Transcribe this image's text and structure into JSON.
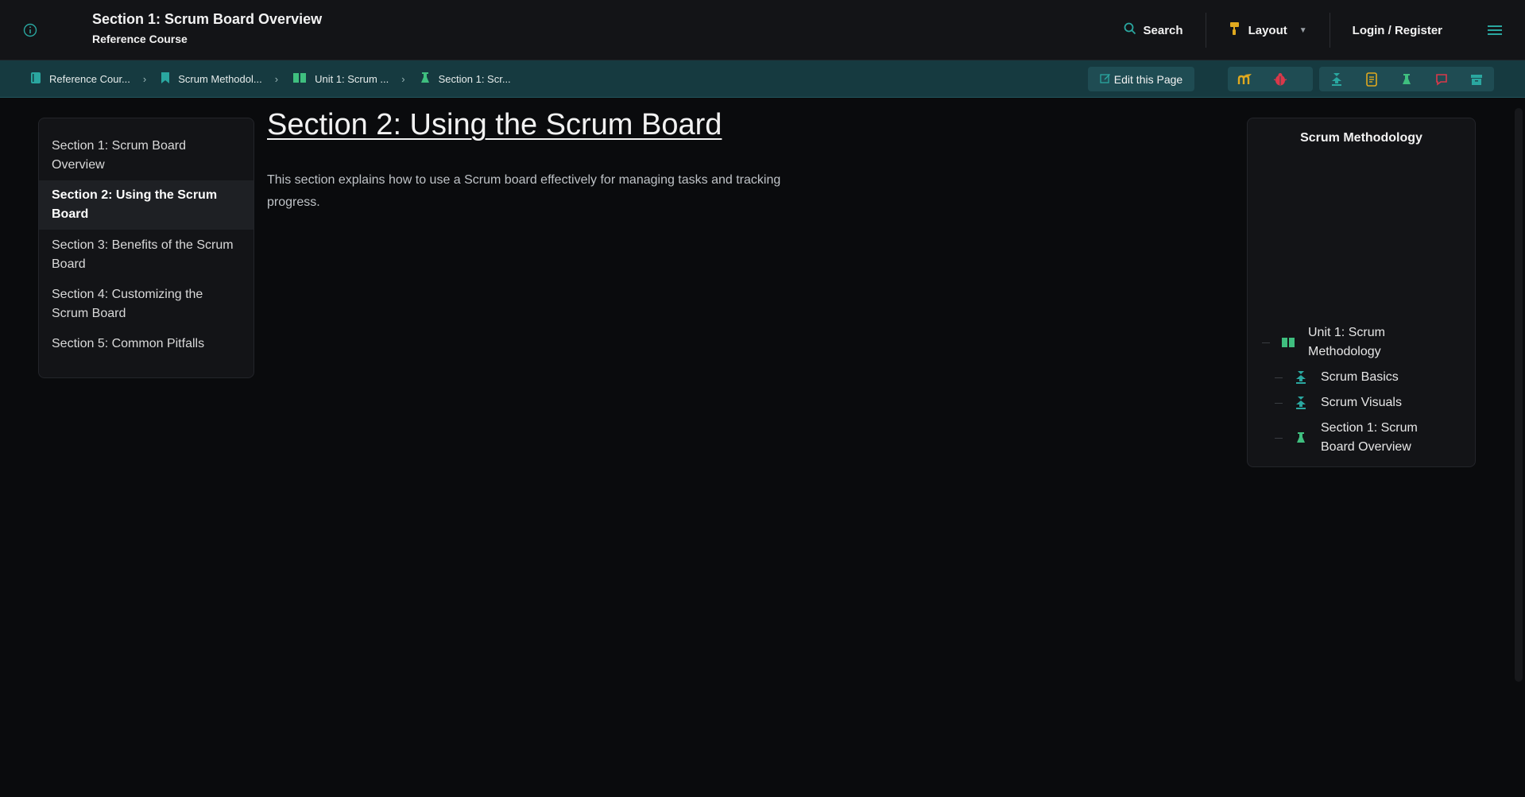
{
  "header": {
    "title": "Section 1: Scrum Board Overview",
    "subtitle": "Reference Course",
    "search_label": "Search",
    "layout_label": "Layout",
    "login_label": "Login / Register"
  },
  "breadcrumbs": [
    {
      "label": "Reference Cour...",
      "icon": "book-icon"
    },
    {
      "label": "Scrum Methodol...",
      "icon": "bookmark-icon"
    },
    {
      "label": "Unit 1: Scrum ...",
      "icon": "open-book-icon"
    },
    {
      "label": "Section 1: Scr...",
      "icon": "flask-icon"
    }
  ],
  "toolbar": {
    "edit_label": "Edit this Page"
  },
  "sidebar": {
    "items": [
      {
        "label": "Section 1: Scrum Board Overview"
      },
      {
        "label": "Section 2: Using the Scrum Board"
      },
      {
        "label": "Section 3: Benefits of the Scrum Board"
      },
      {
        "label": "Section 4: Customizing the Scrum Board"
      },
      {
        "label": "Section 5: Common Pitfalls"
      }
    ],
    "active_index": 1
  },
  "main": {
    "title": "Section 2: Using the Scrum Board",
    "body": "This section explains how to use a Scrum board effectively for managing tasks and tracking progress."
  },
  "right_panel": {
    "title": "Scrum Methodology",
    "tree": [
      {
        "label": "Unit 1: Scrum Methodology",
        "icon": "open-book-icon",
        "level": 0
      },
      {
        "label": "Scrum Basics",
        "icon": "download-icon",
        "level": 1
      },
      {
        "label": "Scrum Visuals",
        "icon": "download-icon",
        "level": 1
      },
      {
        "label": "Section 1: Scrum Board Overview",
        "icon": "flask-icon",
        "level": 1
      }
    ]
  },
  "colors": {
    "teal": "#2aa7a0",
    "green": "#3fbf7f",
    "gold": "#e0a91f",
    "red": "#d9384a"
  }
}
